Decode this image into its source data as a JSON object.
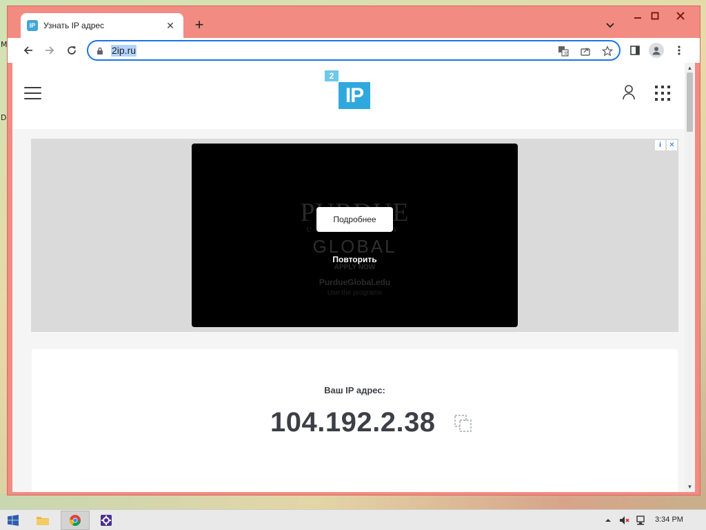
{
  "desktop": {
    "sliver_letters": [
      "M",
      "D"
    ]
  },
  "browser": {
    "tab": {
      "favicon_text": "IP",
      "title": "Узнать IP адрес",
      "close_glyph": "✕"
    },
    "new_tab_glyph": "+",
    "window_buttons": {
      "minimize": "—",
      "maximize": "☐",
      "close": "✕"
    },
    "url": "2ip.ru",
    "accent_color": "#1a73e8",
    "frame_color": "#f28b82"
  },
  "site": {
    "logo": {
      "small": "2",
      "big": "IP"
    },
    "ad": {
      "badge_info": "i",
      "badge_close": "✕",
      "video": {
        "brand": "PURDUE",
        "brand_sub": "UNIVERSITY",
        "global": "GLOBAL",
        "apply": "APPLY NOW",
        "website": "PurdueGlobal.edu",
        "tagline": "Use the programs"
      },
      "more_button": "Подробнее",
      "replay_label": "Повторить"
    },
    "ip_card": {
      "label": "Ваш IP адрес:",
      "ip": "104.192.2.38"
    }
  },
  "taskbar": {
    "clock": "3:34 PM"
  }
}
